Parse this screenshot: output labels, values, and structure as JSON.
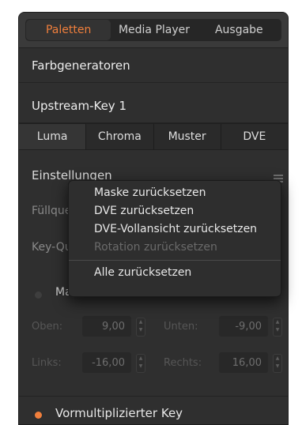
{
  "top_tabs": [
    {
      "label": "Paletten"
    },
    {
      "label": "Media Player"
    },
    {
      "label": "Ausgabe"
    }
  ],
  "sections": {
    "color_generators": "Farbgeneratoren",
    "upstream_key": "Upstream-Key 1"
  },
  "key_tabs": [
    {
      "label": "Luma"
    },
    {
      "label": "Chroma"
    },
    {
      "label": "Muster"
    },
    {
      "label": "DVE"
    }
  ],
  "settings": {
    "title": "Einstellungen",
    "fill_source_label": "Füllque",
    "key_source_label": "Key-Qu"
  },
  "mask": {
    "label": "Maske",
    "top_label": "Oben:",
    "top_value": "9,00",
    "bottom_label": "Unten:",
    "bottom_value": "-9,00",
    "left_label": "Links:",
    "left_value": "-16,00",
    "right_label": "Rechts:",
    "right_value": "16,00"
  },
  "premultiplied": {
    "label": "Vormultiplizierter Key"
  },
  "context_menu": {
    "items": [
      {
        "label": "Maske zurücksetzen",
        "enabled": true
      },
      {
        "label": "DVE zurücksetzen",
        "enabled": true
      },
      {
        "label": "DVE-Vollansicht zurücksetzen",
        "enabled": true
      },
      {
        "label": "Rotation zurücksetzen",
        "enabled": false
      },
      {
        "label": "Alle zurücksetzen",
        "enabled": true
      }
    ]
  },
  "colors": {
    "accent": "#f07f3c",
    "panel_bg": "#2f2f2f",
    "text": "#e6e6e6"
  }
}
